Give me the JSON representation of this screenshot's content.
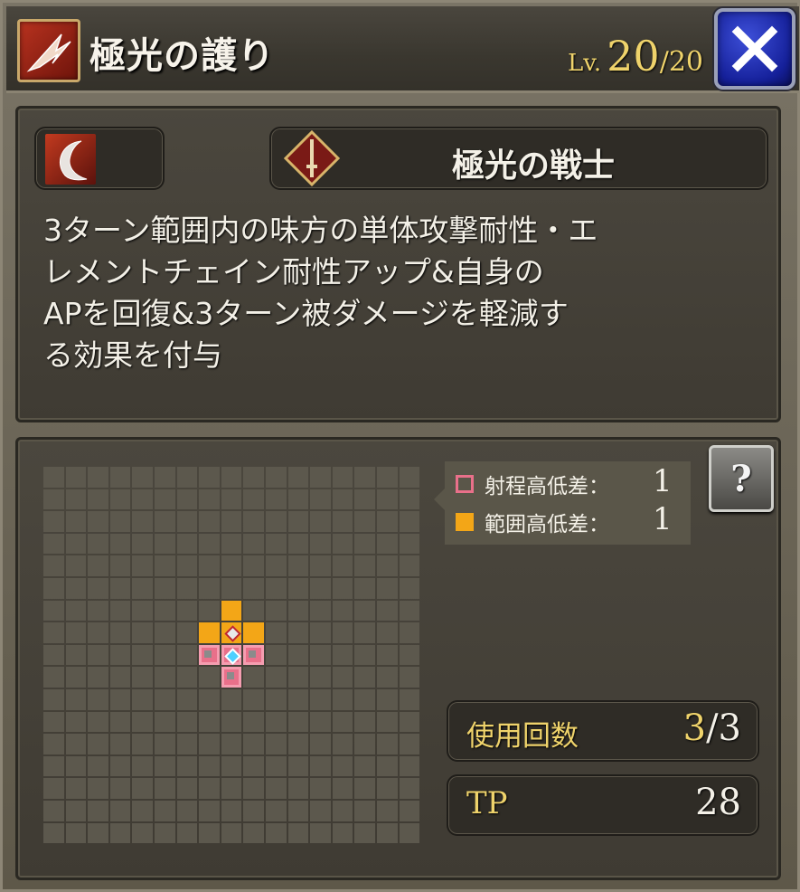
{
  "header": {
    "skill_icon": "claw-slash-icon",
    "title": "極光の護り",
    "level_prefix": "Lv.",
    "level_current": "20",
    "level_slash": "/",
    "level_max": "20",
    "close_icon": "close-x-icon"
  },
  "skill": {
    "element_icon": "crescent-slash-icon",
    "class_icon": "sword-diamond-icon",
    "class_name": "極光の戦士",
    "description": "3ターン範囲内の味方の単体攻撃耐性・エ\nレメントチェイン耐性アップ&自身の\nAPを回復&3ターン被ダメージを軽減す\nる効果を付与"
  },
  "range": {
    "legend": [
      {
        "label": "射程高低差：",
        "value": "1",
        "color": "#e9708a"
      },
      {
        "label": "範囲高低差：",
        "value": "1",
        "color": "#f3a617"
      }
    ],
    "help_label": "?"
  },
  "stats": {
    "uses_label": "使用回数",
    "uses_current": "3",
    "uses_sep": "/",
    "uses_max": "3",
    "tp_label": "TP",
    "tp_value": "28"
  }
}
